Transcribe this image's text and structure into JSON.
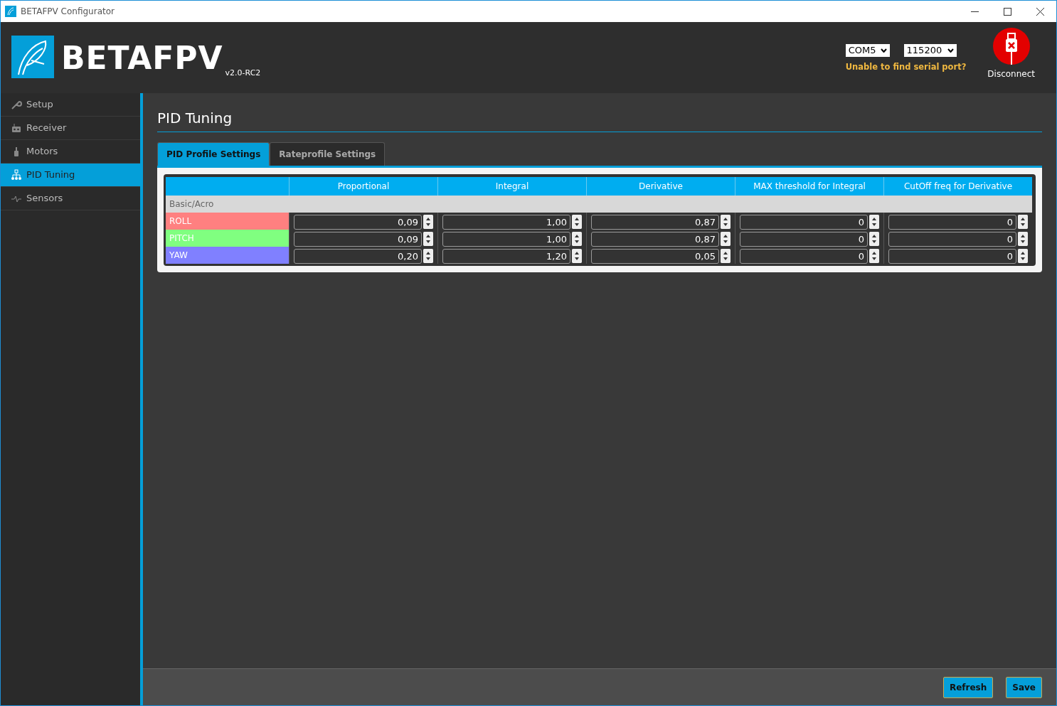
{
  "window": {
    "title": "BETAFPV Configurator"
  },
  "header": {
    "logo_text": "BETAFPV",
    "version": "v2.0-RC2",
    "port": {
      "value": "COM5"
    },
    "baud": {
      "value": "115200"
    },
    "port_help": "Unable to find serial port?",
    "connect_button": "Disconnect"
  },
  "sidebar": {
    "items": [
      {
        "label": "Setup",
        "selected": false
      },
      {
        "label": "Receiver",
        "selected": false
      },
      {
        "label": "Motors",
        "selected": false
      },
      {
        "label": "PID Tuning",
        "selected": true
      },
      {
        "label": "Sensors",
        "selected": false
      }
    ]
  },
  "page_title": "PID Tuning",
  "tabs": [
    {
      "label": "PID Profile Settings",
      "selected": true
    },
    {
      "label": "Rateprofile Settings",
      "selected": false
    }
  ],
  "table": {
    "columns": [
      "Proportional",
      "Integral",
      "Derivative",
      "MAX threshold for Integral",
      "CutOff freq for Derivative"
    ],
    "section": "Basic/Acro",
    "rows": [
      {
        "name": "ROLL",
        "color": "#ff8080",
        "values": [
          "0,09",
          "1,00",
          "0,87",
          "0",
          "0"
        ]
      },
      {
        "name": "PITCH",
        "color": "#80ff80",
        "values": [
          "0,09",
          "1,00",
          "0,87",
          "0",
          "0"
        ]
      },
      {
        "name": "YAW",
        "color": "#8080ff",
        "values": [
          "0,20",
          "1,20",
          "0,05",
          "0",
          "0"
        ]
      }
    ]
  },
  "footer": {
    "buttons": [
      "Refresh",
      "Save"
    ]
  }
}
